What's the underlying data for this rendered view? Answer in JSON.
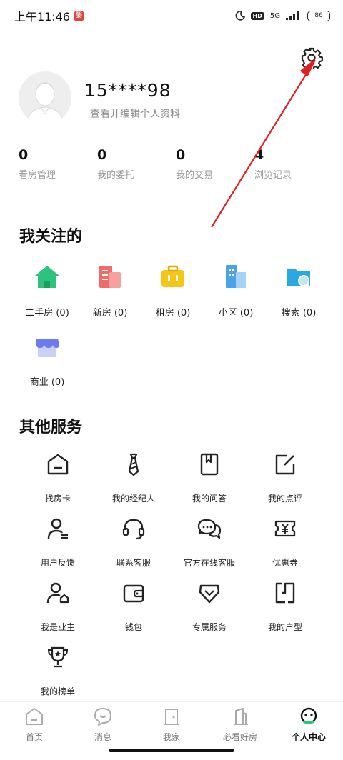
{
  "status_bar": {
    "time": "上午11:46",
    "notification_badge": "嫛",
    "hd": "HD",
    "network": "5G",
    "battery": "86"
  },
  "profile": {
    "username": "15****98",
    "edit_hint": "查看并编辑个人资料"
  },
  "stats": [
    {
      "count": "0",
      "label": "看房管理"
    },
    {
      "count": "0",
      "label": "我的委托"
    },
    {
      "count": "0",
      "label": "我的交易"
    },
    {
      "count": "4",
      "label": "浏览记录"
    }
  ],
  "following": {
    "title": "我关注的",
    "items": [
      {
        "label": "二手房 (0)",
        "icon": "house-icon",
        "color": "#2ec27e"
      },
      {
        "label": "新房 (0)",
        "icon": "building-icon",
        "color": "#f26b6b"
      },
      {
        "label": "租房 (0)",
        "icon": "suitcase-icon",
        "color": "#f5c518"
      },
      {
        "label": "小区 (0)",
        "icon": "community-icon",
        "color": "#4aa3e8"
      },
      {
        "label": "搜索 (0)",
        "icon": "search-folder-icon",
        "color": "#2aa9e0"
      },
      {
        "label": "商业 (0)",
        "icon": "shop-icon",
        "color": "#6a7cf0"
      }
    ]
  },
  "services": {
    "title": "其他服务",
    "items": [
      {
        "label": "找房卡",
        "icon": "house-card-icon"
      },
      {
        "label": "我的经纪人",
        "icon": "tie-icon"
      },
      {
        "label": "我的问答",
        "icon": "book-icon"
      },
      {
        "label": "我的点评",
        "icon": "edit-icon"
      },
      {
        "label": "用户反馈",
        "icon": "user-feedback-icon"
      },
      {
        "label": "联系客服",
        "icon": "headset-icon"
      },
      {
        "label": "官方在线客服",
        "icon": "chat-icon"
      },
      {
        "label": "优惠券",
        "icon": "coupon-icon"
      },
      {
        "label": "我是业主",
        "icon": "owner-icon"
      },
      {
        "label": "钱包",
        "icon": "wallet-icon"
      },
      {
        "label": "专属服务",
        "icon": "heart-shield-icon"
      },
      {
        "label": "我的户型",
        "icon": "floorplan-icon"
      },
      {
        "label": "我的榜单",
        "icon": "trophy-icon"
      }
    ]
  },
  "tabbar": [
    {
      "label": "首页",
      "icon": "home-icon",
      "active": false
    },
    {
      "label": "消息",
      "icon": "message-icon",
      "active": false
    },
    {
      "label": "我家",
      "icon": "door-icon",
      "active": false
    },
    {
      "label": "必看好房",
      "icon": "good-house-icon",
      "active": false
    },
    {
      "label": "个人中心",
      "icon": "profile-face-icon",
      "active": true
    }
  ],
  "colors": {
    "accent_green": "#2ec27e",
    "annotation_red": "#e02020",
    "text_dark": "#111111",
    "text_gray": "#999999"
  }
}
